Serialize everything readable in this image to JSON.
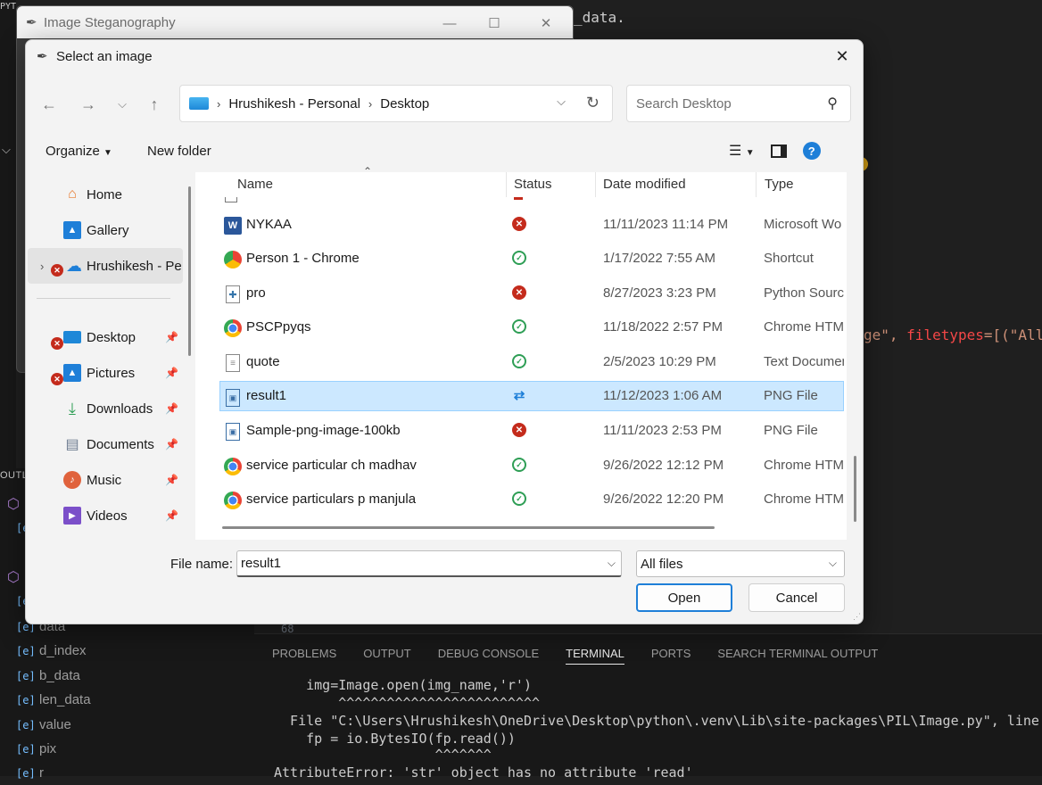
{
  "vscode": {
    "sidebar_title": "PYTHON",
    "outline_title": "OUTLI",
    "outline_items": [
      "data",
      "d_index",
      "b_data",
      "len_data",
      "value",
      "pix",
      "r"
    ],
    "code_fragment_top": "_data.",
    "code_fragment_mid_str": "ge\", ",
    "code_fragment_mid_kw": "filetypes",
    "code_fragment_mid_rest": "=[(\"All",
    "line_number": "68",
    "panel_tabs": [
      "PROBLEMS",
      "OUTPUT",
      "DEBUG CONSOLE",
      "TERMINAL",
      "PORTS",
      "SEARCH TERMINAL OUTPUT"
    ],
    "active_tab": "TERMINAL",
    "terminal_lines": [
      "    img=Image.open(img_name,'r')",
      "        ^^^^^^^^^^^^^^^^^^^^^^^^^",
      "  File \"C:\\Users\\Hrushikesh\\OneDrive\\Desktop\\python\\.venv\\Lib\\site-packages\\PIL\\Image.py\", line",
      "    fp = io.BytesIO(fp.read())",
      "                    ^^^^^^^",
      "AttributeError: 'str' object has no attribute 'read'"
    ]
  },
  "tk_window": {
    "title": "Image Steganography"
  },
  "dialog": {
    "title": "Select an image",
    "breadcrumb": [
      "Hrushikesh - Personal",
      "Desktop"
    ],
    "search_placeholder": "Search Desktop",
    "organize_label": "Organize",
    "new_folder_label": "New folder",
    "help_label": "?",
    "nav_items": [
      {
        "label": "Home",
        "icon": "home-icon",
        "pinned": false
      },
      {
        "label": "Gallery",
        "icon": "gallery-icon",
        "pinned": false
      },
      {
        "label": "Hrushikesh - Pe",
        "icon": "onedrive-icon",
        "pinned": false
      },
      {
        "label": "Desktop",
        "icon": "desktop-icon",
        "pinned": true
      },
      {
        "label": "Pictures",
        "icon": "pictures-icon",
        "pinned": true
      },
      {
        "label": "Downloads",
        "icon": "downloads-icon",
        "pinned": true
      },
      {
        "label": "Documents",
        "icon": "documents-icon",
        "pinned": true
      },
      {
        "label": "Music",
        "icon": "music-icon",
        "pinned": true
      },
      {
        "label": "Videos",
        "icon": "videos-icon",
        "pinned": true
      }
    ],
    "columns": [
      "Name",
      "Status",
      "Date modified",
      "Type"
    ],
    "files": [
      {
        "name": "NYKAA",
        "status": "error",
        "date": "11/11/2023 11:14 PM",
        "type": "Microsoft Wo",
        "icon": "word-icon"
      },
      {
        "name": "Person 1 - Chrome",
        "status": "ok",
        "date": "1/17/2022 7:55 AM",
        "type": "Shortcut",
        "icon": "chrome-shortcut-icon"
      },
      {
        "name": "pro",
        "status": "error",
        "date": "8/27/2023 3:23 PM",
        "type": "Python Source",
        "icon": "python-file-icon"
      },
      {
        "name": "PSCPpyqs",
        "status": "ok",
        "date": "11/18/2022 2:57 PM",
        "type": "Chrome HTM",
        "icon": "chrome-icon"
      },
      {
        "name": "quote",
        "status": "ok",
        "date": "2/5/2023 10:29 PM",
        "type": "Text Documen",
        "icon": "text-file-icon"
      },
      {
        "name": "result1",
        "status": "sync",
        "date": "11/12/2023 1:06 AM",
        "type": "PNG File",
        "icon": "png-file-icon"
      },
      {
        "name": "Sample-png-image-100kb",
        "status": "error",
        "date": "11/11/2023 2:53 PM",
        "type": "PNG File",
        "icon": "png-file-icon"
      },
      {
        "name": "service particular ch madhav",
        "status": "ok",
        "date": "9/26/2022 12:12 PM",
        "type": "Chrome HTM",
        "icon": "chrome-icon"
      },
      {
        "name": "service particulars p manjula",
        "status": "ok",
        "date": "9/26/2022 12:20 PM",
        "type": "Chrome HTM",
        "icon": "chrome-icon"
      }
    ],
    "selected_file": "result1",
    "file_name_label": "File name:",
    "file_name_value": "result1",
    "file_type_value": "All files",
    "open_label": "Open",
    "cancel_label": "Cancel"
  }
}
